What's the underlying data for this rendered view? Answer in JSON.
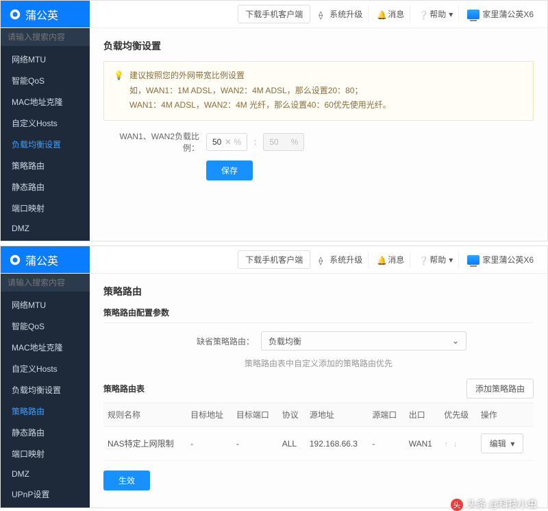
{
  "brand": "蒲公英",
  "top": {
    "download": "下载手机客户端",
    "upgrade": "系统升级",
    "messages": "消息",
    "help": "帮助",
    "device": "家里蒲公英X6"
  },
  "search_placeholder": "请输入搜索内容",
  "panel1": {
    "sidebar": [
      "网络MTU",
      "智能QoS",
      "MAC地址克隆",
      "自定义Hosts",
      "负载均衡设置",
      "策略路由",
      "静态路由",
      "端口映射",
      "DMZ"
    ],
    "active_index": 4,
    "title": "负载均衡设置",
    "tip_title": "建议按照您的外网带宽比例设置",
    "tip_line1": "如，WAN1：1M ADSL，WAN2：4M ADSL，那么设置20：80；",
    "tip_line2": "WAN1：4M ADSL，WAN2：4M 光纤，那么设置40：60优先使用光纤。",
    "ratio_label": "WAN1、WAN2负载比例：",
    "ratio1": "50",
    "ratio2": "50",
    "unit_x": "✕",
    "unit_pct": "%",
    "save": "保存"
  },
  "panel2": {
    "sidebar": [
      "网络MTU",
      "智能QoS",
      "MAC地址克隆",
      "自定义Hosts",
      "负载均衡设置",
      "策略路由",
      "静态路由",
      "端口映射",
      "DMZ",
      "UPnP设置"
    ],
    "active_index": 5,
    "title": "策略路由",
    "config_title": "策略路由配置参数",
    "default_label": "缺省策略路由：",
    "default_value": "负载均衡",
    "hint": "策略路由表中自定义添加的策略路由优先",
    "table_title": "策略路由表",
    "add_btn": "添加策略路由",
    "headers": [
      "规则名称",
      "目标地址",
      "目标端口",
      "协议",
      "源地址",
      "源端口",
      "出口",
      "优先级",
      "操作"
    ],
    "row": {
      "name": "NAS特定上网限制",
      "target_addr": "-",
      "target_port": "-",
      "protocol": "ALL",
      "src_addr": "192.168.66.3",
      "src_port": "-",
      "exit": "WAN1",
      "priority": "↑ ↓",
      "action": "编辑"
    },
    "apply": "生效"
  },
  "watermark": "头条 @科技小虫"
}
